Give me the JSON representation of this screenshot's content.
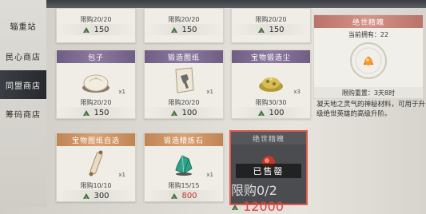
{
  "sidebar": {
    "items": [
      {
        "label": "辎重站"
      },
      {
        "label": "民心商店"
      },
      {
        "label": "同盟商店"
      },
      {
        "label": "筹码商店"
      }
    ]
  },
  "top_row": [
    {
      "limit": "限购20/20",
      "price": "150"
    },
    {
      "limit": "限购20/20",
      "price": "150"
    },
    {
      "limit": "限购20/20",
      "price": "150"
    }
  ],
  "cards": [
    {
      "title": "包子",
      "qty": "x1",
      "limit": "限购20/20",
      "price": "150",
      "icon": "steamed-bun-icon"
    },
    {
      "title": "锻造图纸",
      "qty": "x1",
      "limit": "限购20/20",
      "price": "100",
      "icon": "blueprint-scroll-icon"
    },
    {
      "title": "宝物锻造尘",
      "qty": "x3",
      "limit": "限购30/30",
      "price": "100",
      "icon": "gold-dust-icon"
    },
    {
      "title": "宝物图纸自选",
      "qty": "x1",
      "limit": "限购10/10",
      "price": "300",
      "icon": "scroll-roll-icon"
    },
    {
      "title": "锻造精炼石",
      "qty": "x1",
      "limit": "限购15/15",
      "price": "800",
      "icon": "green-crystal-icon"
    }
  ],
  "sold_card": {
    "title": "绝世精魄",
    "status": "已售罄",
    "limit": "限购0/2",
    "price": "12000"
  },
  "detail": {
    "title": "绝世精魄",
    "owned": "当前拥有：22",
    "reset": "限购重置：3天8时",
    "description": "凝天地之灵气的神秘材料，可用于升级绝世英雄的高级升阶。"
  },
  "colors": {
    "accent_red": "#e05a4b",
    "active_tab": "#2b2f34",
    "price_red": "#c0392b"
  }
}
